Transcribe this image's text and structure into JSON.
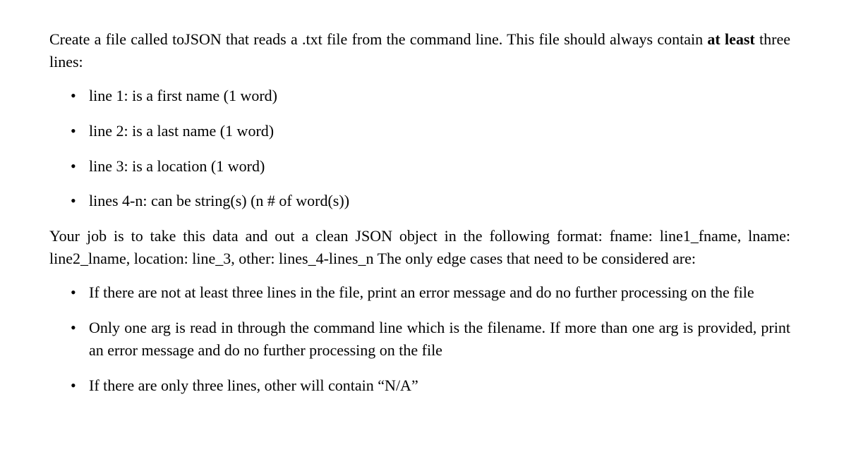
{
  "intro_part1": "Create a file called toJSON that reads a .txt file from the command line. This file should always contain ",
  "intro_bold": "at least",
  "intro_part2": " three lines:",
  "list1": [
    "line 1: is a first name (1 word)",
    "line 2: is a last name (1 word)",
    "line 3: is a location (1 word)",
    "lines 4-n: can be string(s) (n # of word(s))"
  ],
  "para2_line1": "Your job is to take this data and out a clean JSON object in the following format:",
  "para2_line2": "fname: line1_fname, lname: line2_lname, location: line_3, other: lines_4-lines_n",
  "para2_line3": "The only edge cases that need to be considered are:",
  "list2": [
    "If there are not at least three lines in the file, print an error message and do no further processing on the file",
    "Only one arg is read in through the command line which is the filename. If more than one arg is provided, print an error message and do no further processing on the file",
    "If there are only three lines, other will contain “N/A”"
  ]
}
